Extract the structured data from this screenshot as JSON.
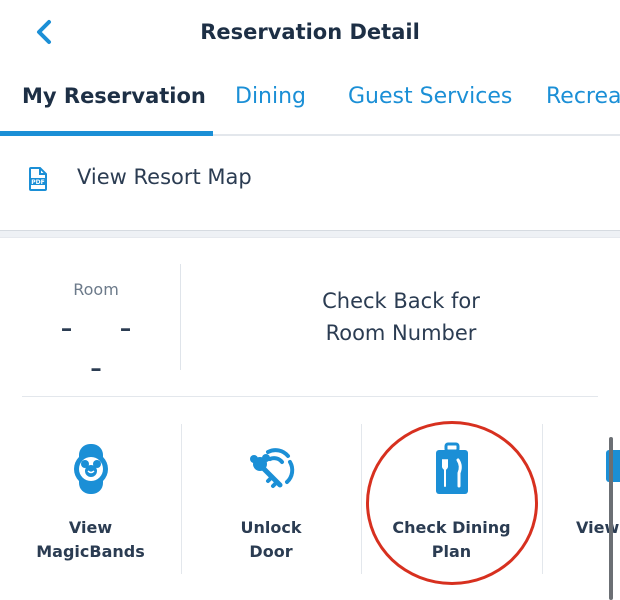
{
  "header": {
    "title": "Reservation Detail"
  },
  "tabs": [
    {
      "label": "My Reservation"
    },
    {
      "label": "Dining"
    },
    {
      "label": "Guest Services"
    },
    {
      "label": "Recreat"
    }
  ],
  "resort_map": {
    "icon": "pdf-icon",
    "label": "View Resort Map"
  },
  "room": {
    "label": "Room",
    "value": "- - -"
  },
  "check_back": {
    "line1": "Check Back for",
    "line2": "Room Number"
  },
  "actions": [
    {
      "icon": "magicband-icon",
      "line1": "View",
      "line2": "MagicBands"
    },
    {
      "icon": "key-icon",
      "line1": "Unlock",
      "line2": "Door"
    },
    {
      "icon": "dining-plan-icon",
      "line1": "Check Dining",
      "line2": "Plan"
    },
    {
      "icon": "partial-icon",
      "line1": "View",
      "line2": ""
    }
  ],
  "colors": {
    "accent": "#1b8fd6",
    "text": "#253b56",
    "highlight": "#d7301f"
  }
}
